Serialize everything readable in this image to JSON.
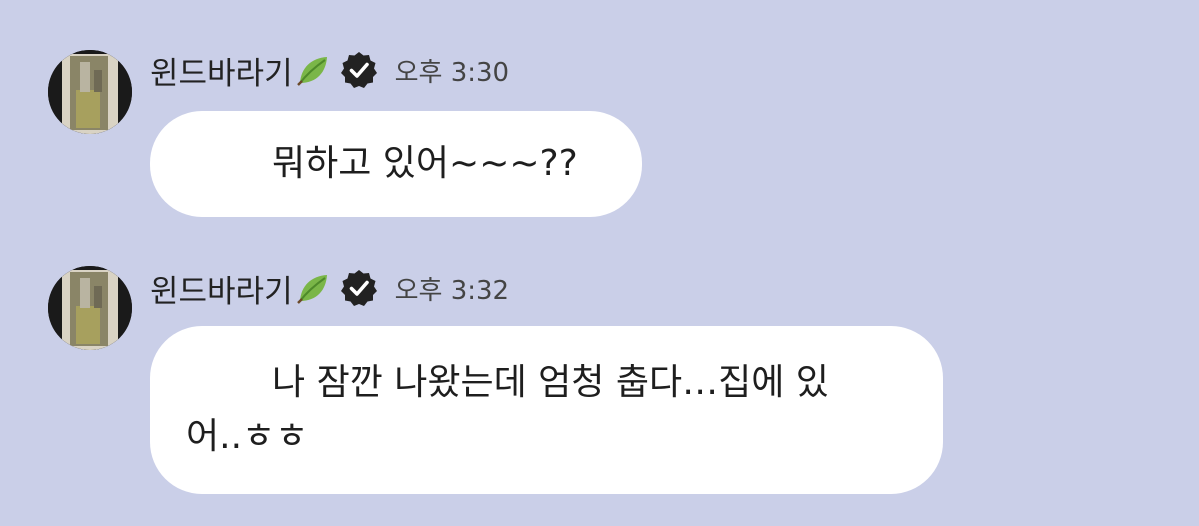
{
  "messages": [
    {
      "sender": "윈드바라기",
      "sender_icon": "leaf-icon",
      "verified_icon": "verified-badge-icon",
      "time": "오후 3:30",
      "lines": [
        "뭐하고 있어~~~??"
      ]
    },
    {
      "sender": "윈드바라기",
      "sender_icon": "leaf-icon",
      "verified_icon": "verified-badge-icon",
      "time": "오후 3:32",
      "lines": [
        "나 잠깐 나왔는데 엄청 춥다…집에 있",
        "어..ㅎㅎ"
      ]
    }
  ],
  "colors": {
    "background": "#cacfe8",
    "bubble": "#ffffff",
    "text": "#1e1e1e",
    "leaf": "#7ab648",
    "verified_badge": "#222222"
  }
}
